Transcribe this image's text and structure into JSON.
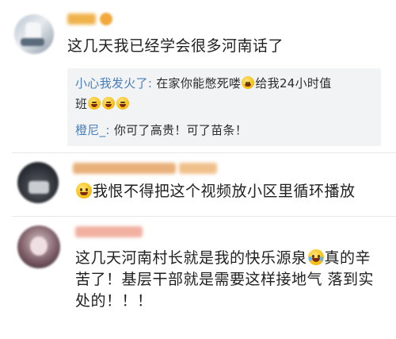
{
  "comments": [
    {
      "text": "这几天我已经学会很多河南话了",
      "replies": [
        {
          "name": "小心我发火了",
          "sep": ":",
          "text_a": " 在家你能憋死喽",
          "text_b": "给我24小时值",
          "text_c": "班"
        },
        {
          "name": "橙尼_",
          "sep": ":",
          "text": " 你可了高贵！可了苗条！"
        }
      ]
    },
    {
      "text": "我恨不得把这个视频放小区里循环播放"
    },
    {
      "line1_a": "这几天河南村长就是我的快乐源泉",
      "line1_b": "真的辛",
      "line2": "苦了！基层干部就是需要这样接地气 落到实",
      "line3": "处的！！！"
    }
  ],
  "colors": {
    "reply_name": "#4a7eb8",
    "reply_bg": "#f2f3f5",
    "text": "#1f1f1f"
  },
  "icons": [
    "smile-emoji-icon",
    "laugh-cry-emoji-icon",
    "shy-smile-emoji-icon",
    "laughing-emoji-icon"
  ]
}
